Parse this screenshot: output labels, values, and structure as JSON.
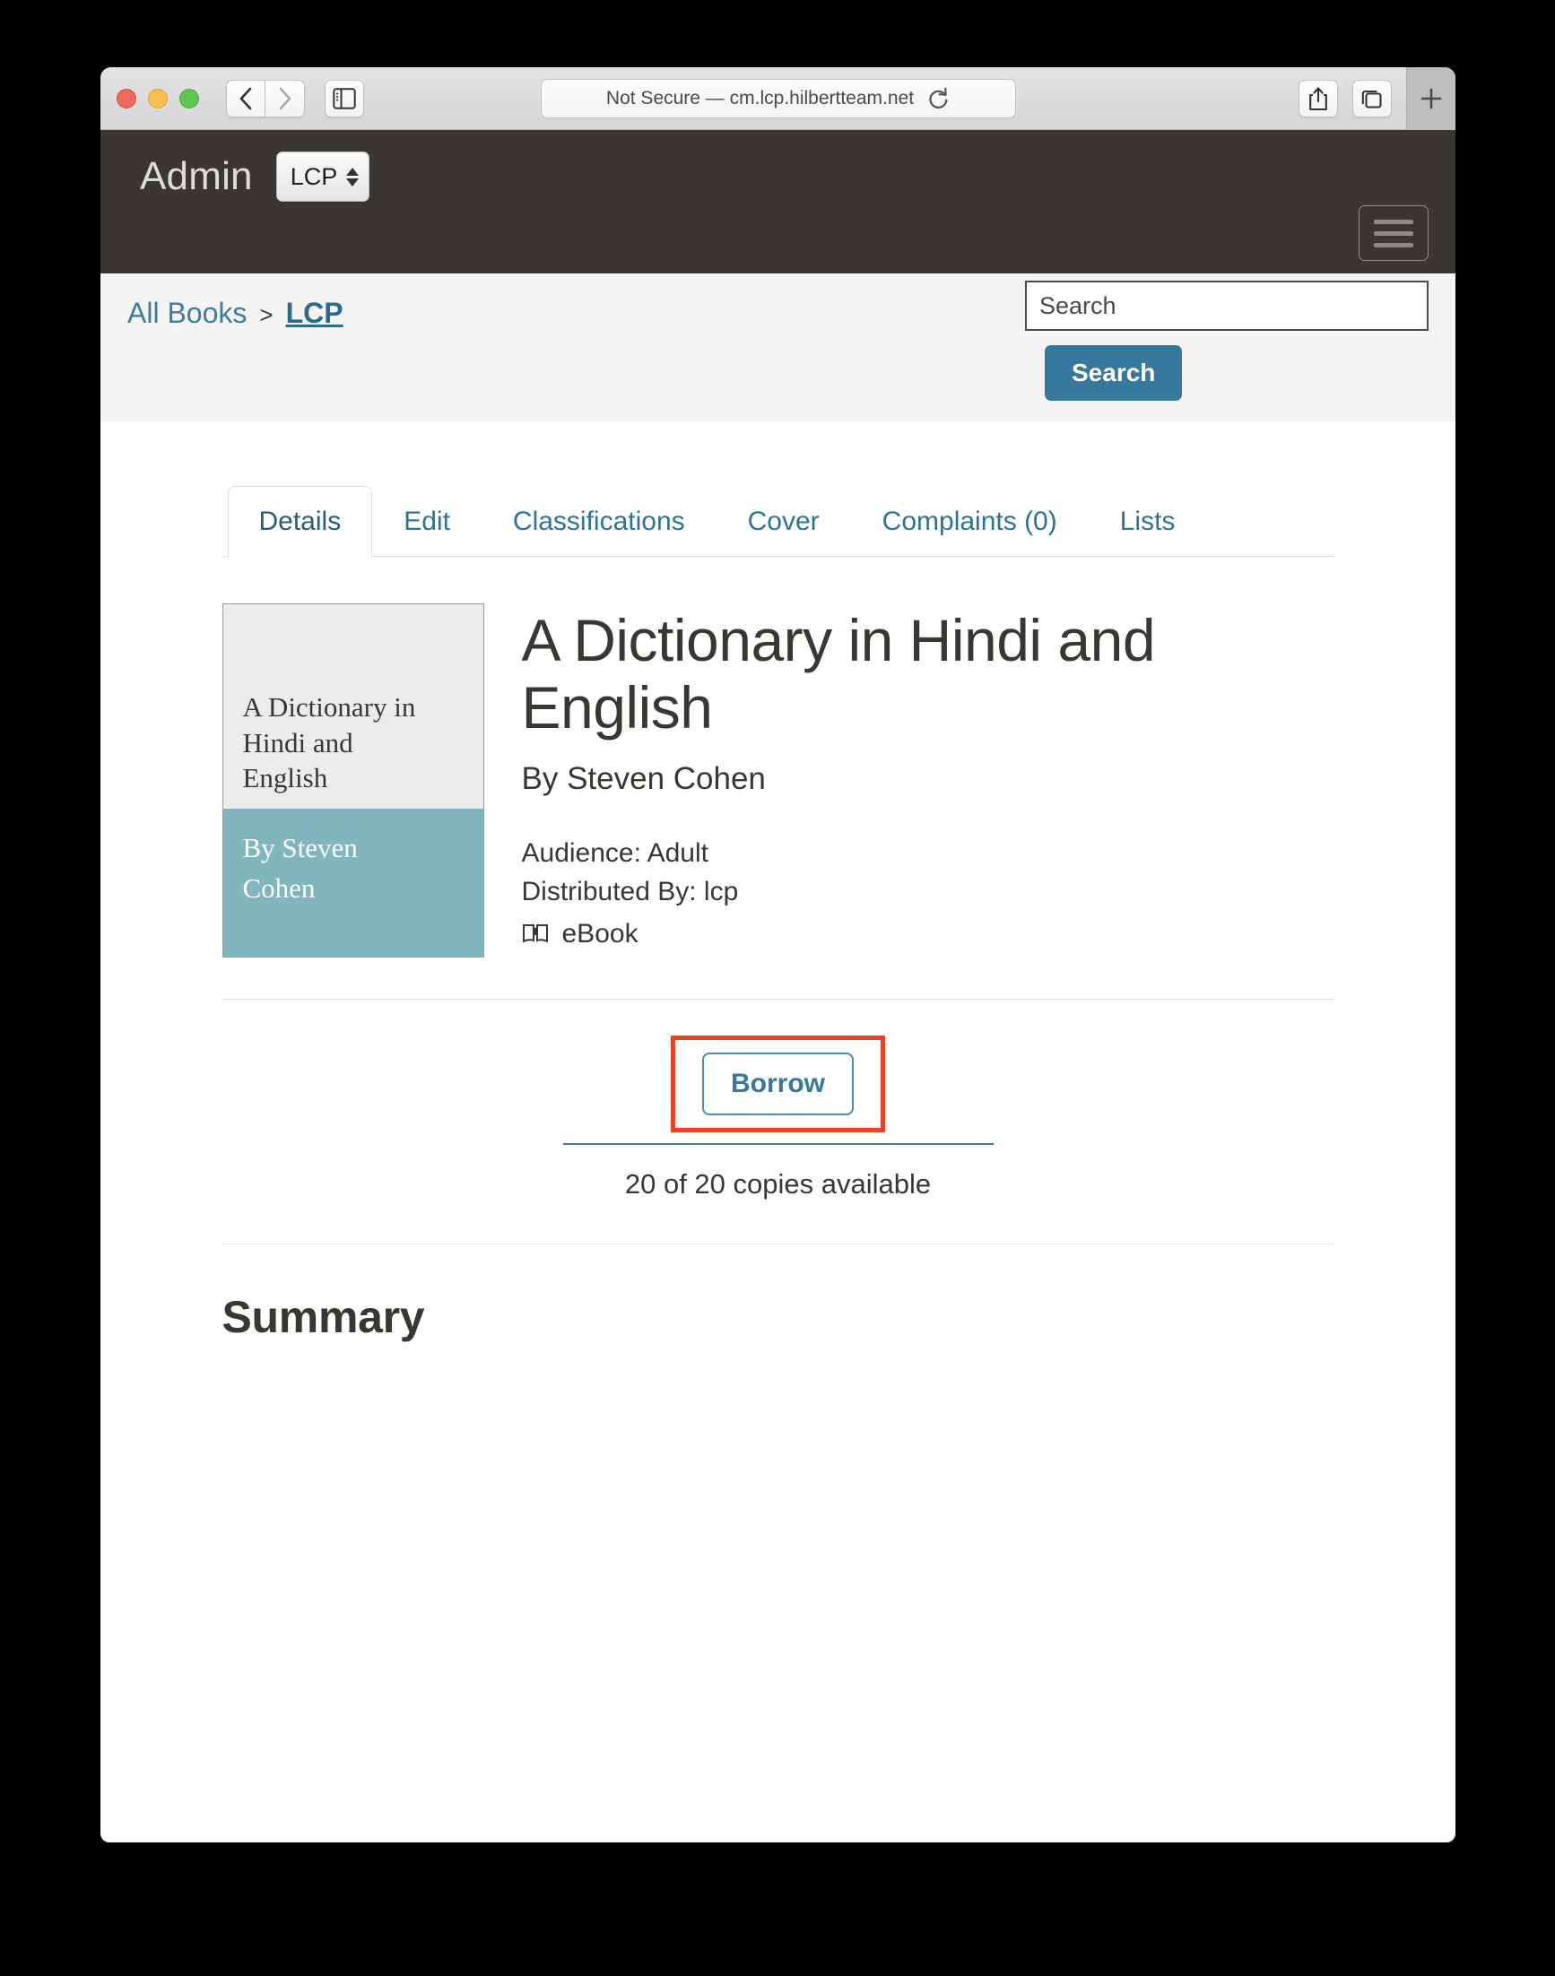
{
  "browser": {
    "url_text": "Not Secure — cm.lcp.hilbertteam.net",
    "icons": {
      "back": "back-chevron-icon",
      "forward": "forward-chevron-icon",
      "sidebar": "sidebar-toggle-icon",
      "reload": "reload-icon",
      "share": "share-icon",
      "tab_overview": "tab-overview-icon",
      "new_tab": "plus-icon"
    }
  },
  "app_header": {
    "brand": "Admin",
    "library_select_value": "LCP",
    "menu_icon": "hamburger-icon"
  },
  "sub_header": {
    "breadcrumb": {
      "root_label": "All Books",
      "separator": ">",
      "current_label": "LCP"
    },
    "search": {
      "placeholder": "Search",
      "value": "",
      "button_label": "Search"
    }
  },
  "tabs": [
    {
      "label": "Details",
      "active": true
    },
    {
      "label": "Edit",
      "active": false
    },
    {
      "label": "Classifications",
      "active": false
    },
    {
      "label": "Cover",
      "active": false
    },
    {
      "label": "Complaints (0)",
      "active": false
    },
    {
      "label": "Lists",
      "active": false
    }
  ],
  "book": {
    "cover": {
      "title_line_1": "A Dictionary in",
      "title_line_2": "Hindi and",
      "title_line_3": "English",
      "author_line_1": "By Steven",
      "author_line_2": "Cohen"
    },
    "title": "A Dictionary in Hindi and English",
    "byline": "By Steven Cohen",
    "audience": "Audience: Adult",
    "distributed_by": "Distributed By: lcp",
    "format_label": "eBook",
    "format_icon": "open-book-icon"
  },
  "borrow": {
    "button_label": "Borrow",
    "copies_text": "20 of 20 copies available",
    "highlight_color": "#ec4125"
  },
  "summary": {
    "heading": "Summary",
    "body": ""
  },
  "colors": {
    "accent_blue": "#36789e",
    "link_blue": "#3b7ea1",
    "header_dark": "#3a3733",
    "cover_teal": "#82b6bf",
    "highlight_red": "#ec4125"
  }
}
